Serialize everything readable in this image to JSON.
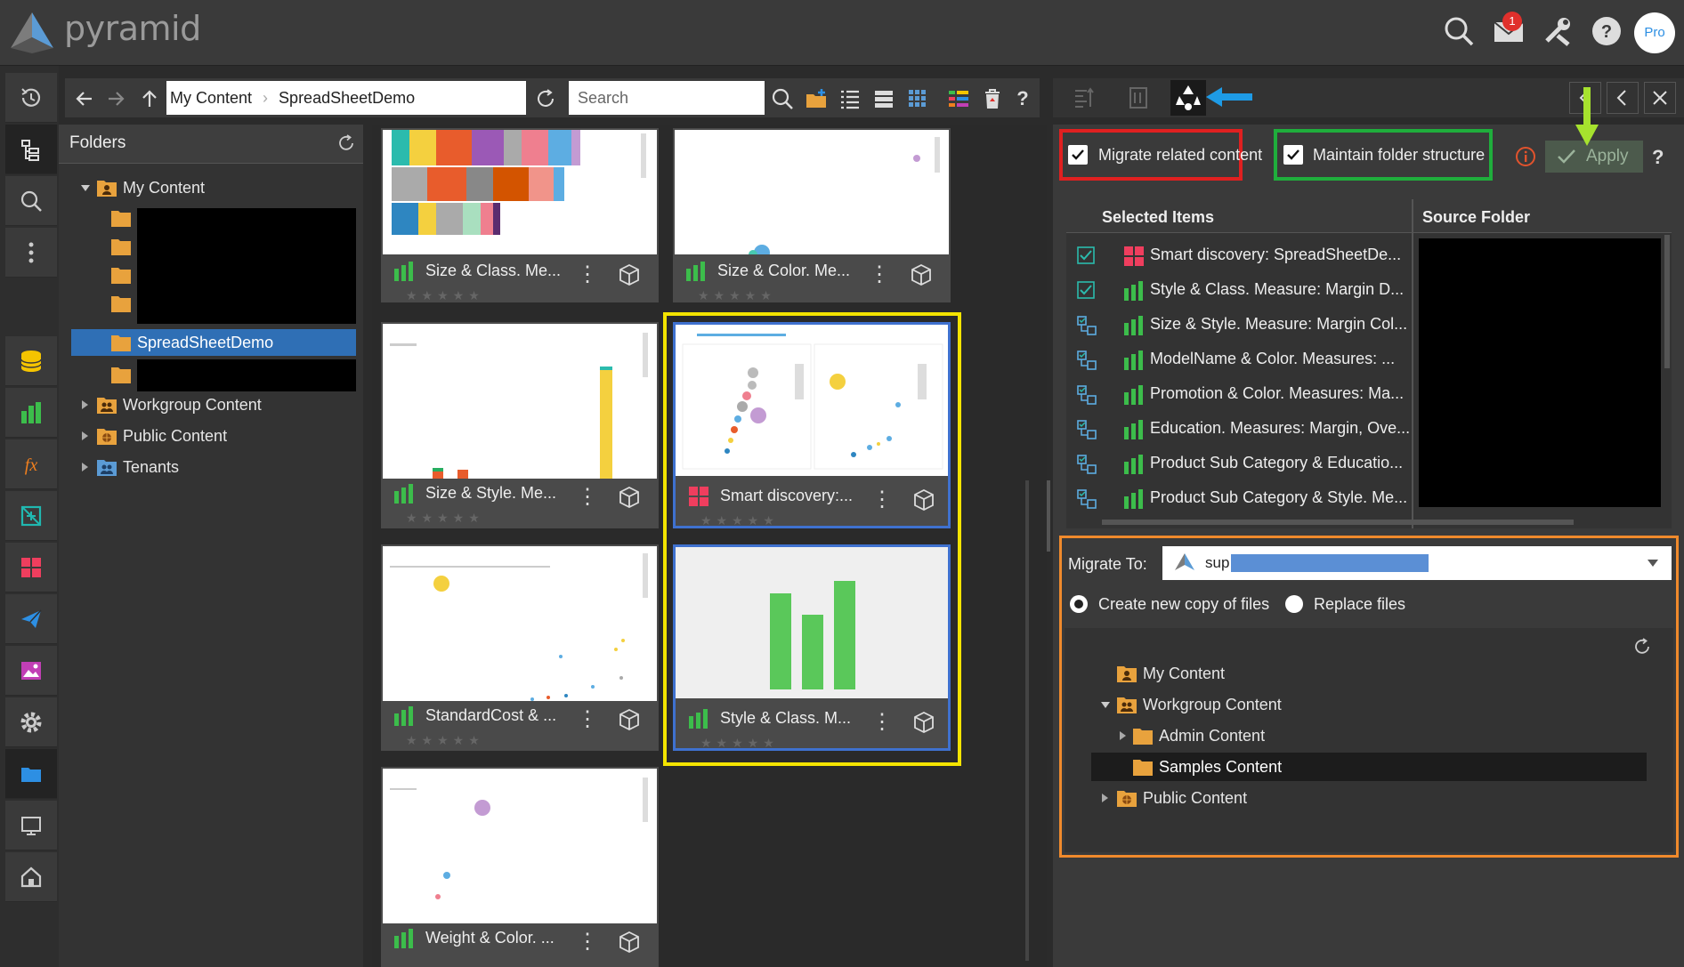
{
  "app": {
    "name": "pyramid"
  },
  "header": {
    "notification_count": "1",
    "user_initials": "Pro"
  },
  "nav": {
    "items": [
      "recent",
      "content",
      "search",
      "more",
      "data",
      "discover",
      "formulate",
      "model",
      "present",
      "publish",
      "illustrate",
      "admin",
      "content-manager",
      "present-mode",
      "home"
    ]
  },
  "addressbar": {
    "breadcrumb": [
      "My Content",
      "SpreadSheetDemo"
    ],
    "search_placeholder": "Search"
  },
  "folders": {
    "title": "Folders",
    "tree": {
      "root": "My Content",
      "selected": "SpreadSheetDemo",
      "others": [
        "Workgroup Content",
        "Public Content",
        "Tenants"
      ]
    }
  },
  "cards": [
    {
      "label": "Size & Class. Me...",
      "type": "chart"
    },
    {
      "label": "Size & Color. Me...",
      "type": "chart"
    },
    {
      "label": "Size & Style. Me...",
      "type": "chart"
    },
    {
      "label": "Smart discovery:...",
      "type": "discovery"
    },
    {
      "label": "StandardCost & ...",
      "type": "chart"
    },
    {
      "label": "Style & Class. M...",
      "type": "chart"
    },
    {
      "label": "Weight & Color. ...",
      "type": "chart"
    }
  ],
  "migrate_panel": {
    "migrate_related": "Migrate related content",
    "maintain_structure": "Maintain folder structure",
    "apply": "Apply",
    "help": "?",
    "columns": [
      "Selected Items",
      "Source Folder"
    ],
    "items": [
      {
        "label": "Smart discovery: SpreadSheetDe...",
        "type": "discovery",
        "check": "checked"
      },
      {
        "label": "Style & Class. Measure: Margin D...",
        "type": "chart",
        "check": "checked"
      },
      {
        "label": "Size & Style. Measure: Margin Col...",
        "type": "chart",
        "check": "related"
      },
      {
        "label": "ModelName & Color. Measures: ...",
        "type": "chart",
        "check": "related"
      },
      {
        "label": "Promotion & Color. Measures: Ma...",
        "type": "chart",
        "check": "related"
      },
      {
        "label": "Education. Measures: Margin, Ove...",
        "type": "chart",
        "check": "related"
      },
      {
        "label": "Product Sub Category & Educatio...",
        "type": "chart",
        "check": "related"
      },
      {
        "label": "Product Sub Category & Style. Me...",
        "type": "chart",
        "check": "related"
      }
    ],
    "migrate_to_label": "Migrate To:",
    "migrate_to_value": "sup",
    "option_new_copy": "Create new copy of files",
    "option_replace": "Replace files",
    "target_tree": [
      "My Content",
      "Workgroup Content",
      "Admin Content",
      "Samples Content",
      "Public Content"
    ]
  },
  "colors": {
    "annotation_red": "#e02020",
    "annotation_green": "#1fae3c",
    "annotation_yellow": "#f4e400",
    "annotation_orange": "#f08a2c",
    "annotation_blue": "#1e9be6",
    "annotation_lime": "#a6e22e"
  }
}
